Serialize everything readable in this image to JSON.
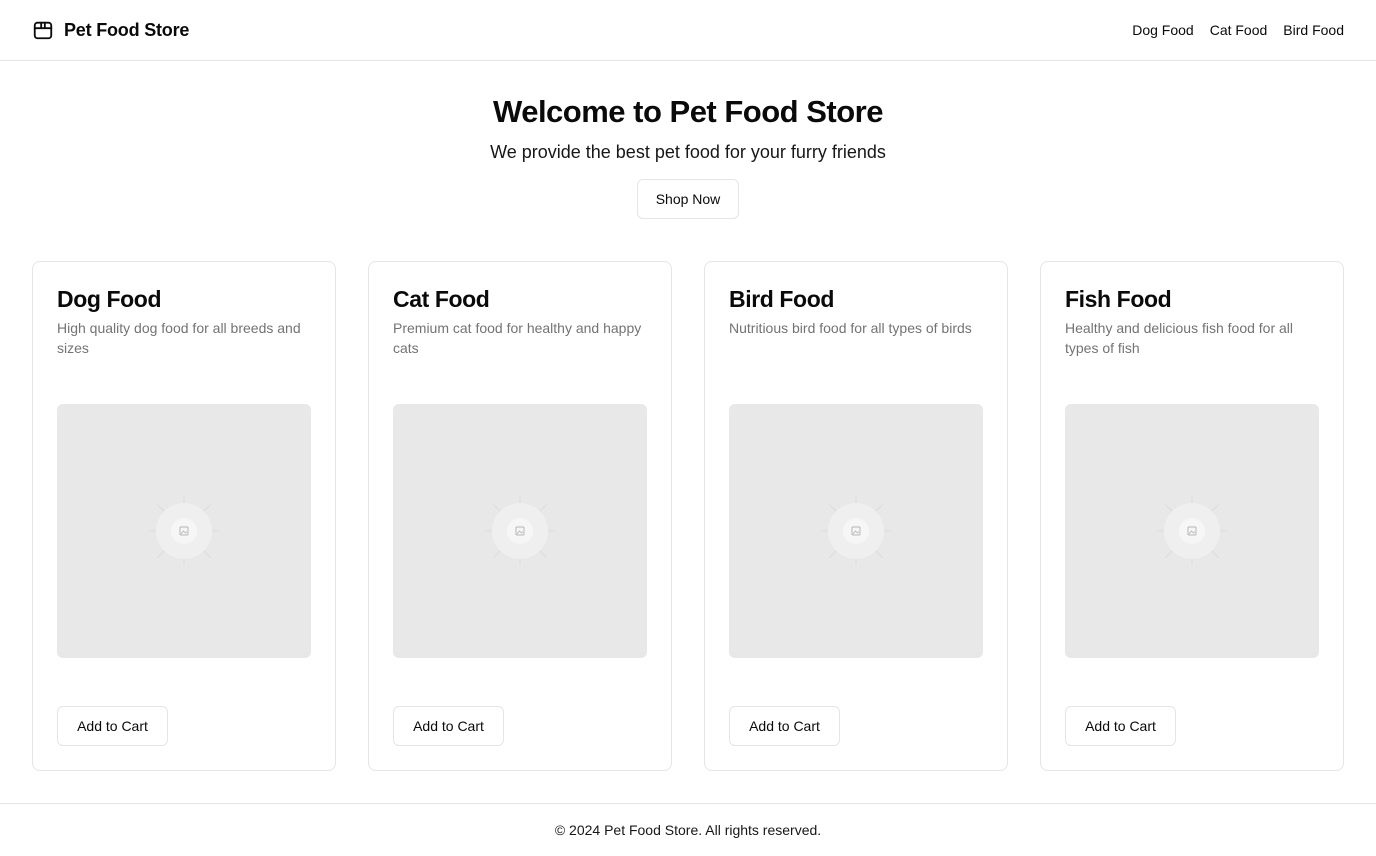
{
  "header": {
    "brand": "Pet Food Store",
    "brand_icon": "package-icon",
    "nav": [
      {
        "label": "Dog Food"
      },
      {
        "label": "Cat Food"
      },
      {
        "label": "Bird Food"
      }
    ]
  },
  "hero": {
    "title": "Welcome to Pet Food Store",
    "subtitle": "We provide the best pet food for your furry friends",
    "cta_label": "Shop Now"
  },
  "products": [
    {
      "title": "Dog Food",
      "description": "High quality dog food for all breeds and sizes",
      "button_label": "Add to Cart",
      "image_icon": "image-placeholder-icon"
    },
    {
      "title": "Cat Food",
      "description": "Premium cat food for healthy and happy cats",
      "button_label": "Add to Cart",
      "image_icon": "image-placeholder-icon"
    },
    {
      "title": "Bird Food",
      "description": "Nutritious bird food for all types of birds",
      "button_label": "Add to Cart",
      "image_icon": "image-placeholder-icon"
    },
    {
      "title": "Fish Food",
      "description": "Healthy and delicious fish food for all types of fish",
      "button_label": "Add to Cart",
      "image_icon": "image-placeholder-icon"
    }
  ],
  "footer": {
    "text": "© 2024 Pet Food Store. All rights reserved."
  },
  "colors": {
    "border": "#e5e5e5",
    "muted_text": "#737373",
    "image_placeholder": "#e8e8e8"
  }
}
